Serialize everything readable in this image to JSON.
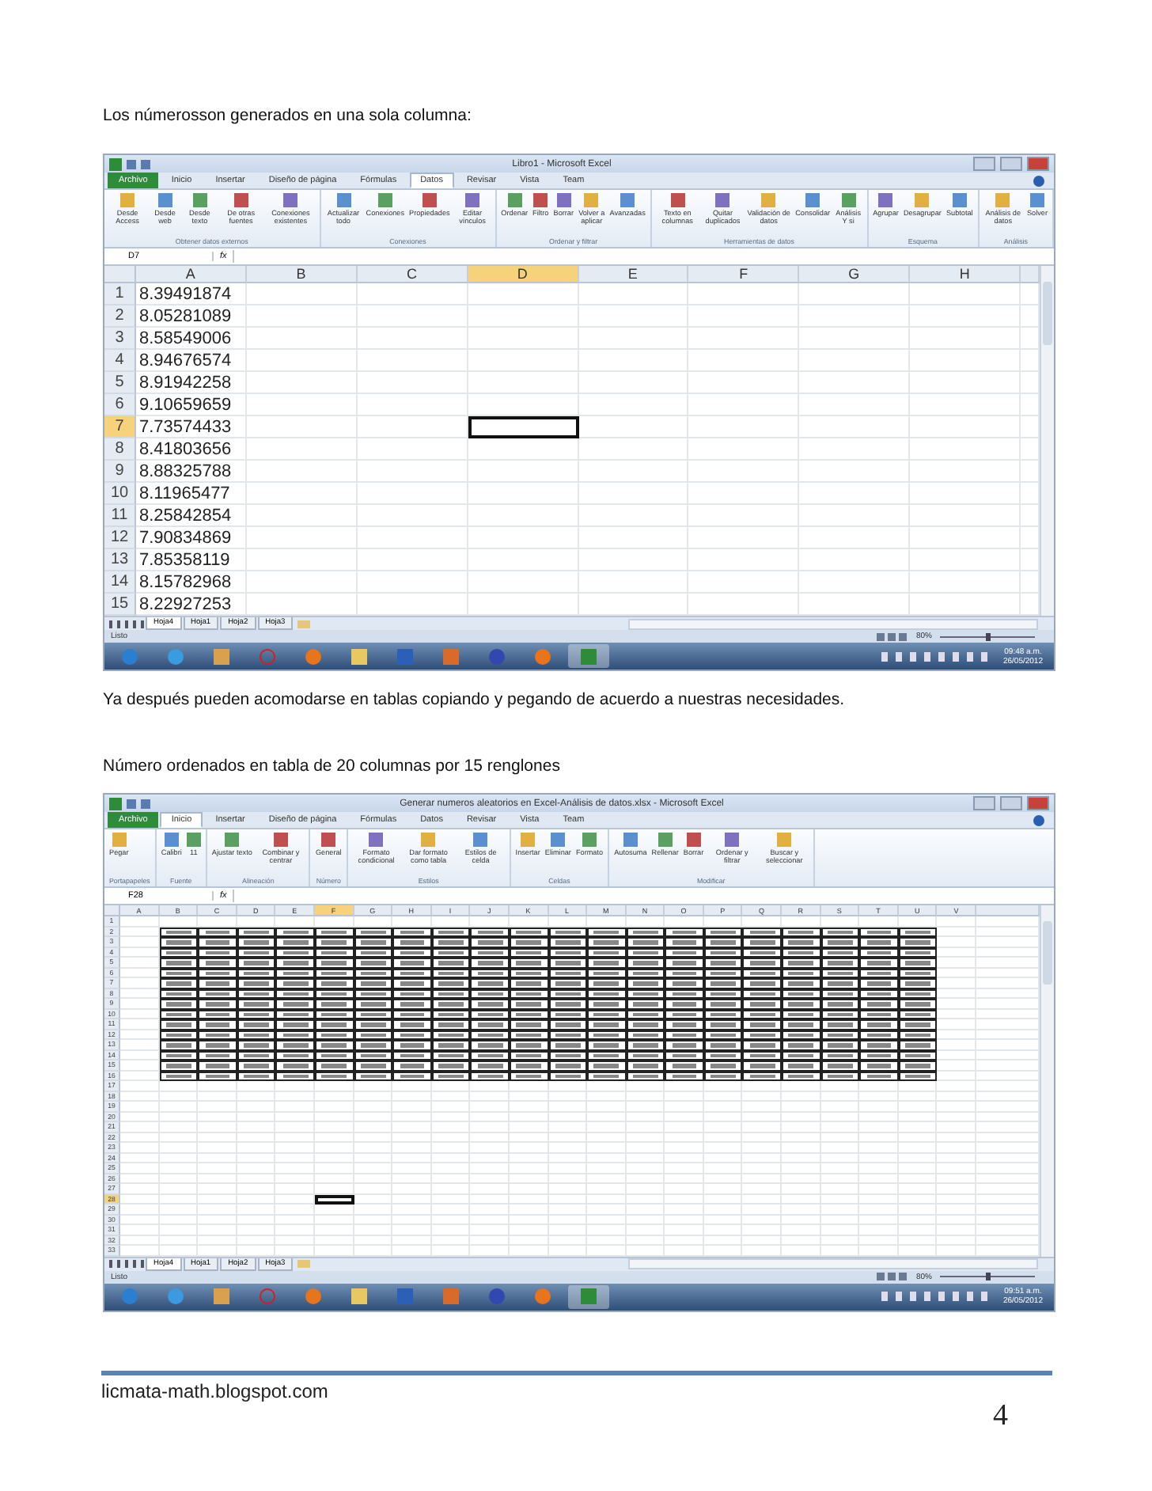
{
  "blocks": [
    {
      "kind": "text",
      "text": "Los númerosson generados en una sola columna:"
    },
    {
      "kind": "excel",
      "title": "Libro1 - Microsoft Excel",
      "tabs": [
        {
          "label": "Archivo",
          "kind": "file",
          "selected": false
        },
        {
          "label": "Inicio",
          "kind": "tab",
          "selected": false
        },
        {
          "label": "Insertar",
          "kind": "tab",
          "selected": false
        },
        {
          "label": "Diseño de página",
          "kind": "tab",
          "selected": false
        },
        {
          "label": "Fórmulas",
          "kind": "tab",
          "selected": false
        },
        {
          "label": "Datos",
          "kind": "tab",
          "selected": true
        },
        {
          "label": "Revisar",
          "kind": "tab",
          "selected": false
        },
        {
          "label": "Vista",
          "kind": "tab",
          "selected": false
        },
        {
          "label": "Team",
          "kind": "tab",
          "selected": false
        }
      ],
      "ribbon": [
        {
          "label": "Obtener datos externos",
          "commands": [
            "Desde Access",
            "Desde web",
            "Desde texto",
            "De otras fuentes",
            "Conexiones existentes"
          ]
        },
        {
          "label": "Conexiones",
          "commands": [
            "Actualizar todo",
            "Conexiones",
            "Propiedades",
            "Editar vínculos"
          ]
        },
        {
          "label": "Ordenar y filtrar",
          "commands": [
            "Ordenar",
            "Filtro",
            "Borrar",
            "Volver a aplicar",
            "Avanzadas"
          ]
        },
        {
          "label": "Herramientas de datos",
          "commands": [
            "Texto en columnas",
            "Quitar duplicados",
            "Validación de datos",
            "Consolidar",
            "Análisis Y si"
          ]
        },
        {
          "label": "Esquema",
          "commands": [
            "Agrupar",
            "Desagrupar",
            "Subtotal"
          ]
        },
        {
          "label": "Análisis",
          "commands": [
            "Análisis de datos",
            "Solver"
          ]
        }
      ],
      "name_box": "D7",
      "function_label": "fx",
      "grid": {
        "kind": "values",
        "columns": [
          {
            "label": "A",
            "kind": "data",
            "selected": false
          },
          {
            "label": "B",
            "kind": "empty",
            "selected": false
          },
          {
            "label": "C",
            "kind": "empty",
            "selected": false
          },
          {
            "label": "D",
            "kind": "empty",
            "selected": true
          },
          {
            "label": "E",
            "kind": "empty",
            "selected": false
          },
          {
            "label": "F",
            "kind": "empty",
            "selected": false
          },
          {
            "label": "G",
            "kind": "empty",
            "selected": false
          },
          {
            "label": "H",
            "kind": "empty",
            "selected": false
          }
        ],
        "rows": [
          {
            "number": "1",
            "selected": false,
            "value": "8.39491874"
          },
          {
            "number": "2",
            "selected": false,
            "value": "8.05281089"
          },
          {
            "number": "3",
            "selected": false,
            "value": "8.58549006"
          },
          {
            "number": "4",
            "selected": false,
            "value": "8.94676574"
          },
          {
            "number": "5",
            "selected": false,
            "value": "8.91942258"
          },
          {
            "number": "6",
            "selected": false,
            "value": "9.10659659"
          },
          {
            "number": "7",
            "selected": true,
            "value": "7.73574433"
          },
          {
            "number": "8",
            "selected": false,
            "value": "8.41803656"
          },
          {
            "number": "9",
            "selected": false,
            "value": "8.88325788"
          },
          {
            "number": "10",
            "selected": false,
            "value": "8.11965477"
          },
          {
            "number": "11",
            "selected": false,
            "value": "8.25842854"
          },
          {
            "number": "12",
            "selected": false,
            "value": "7.90834869"
          },
          {
            "number": "13",
            "selected": false,
            "value": "7.85358119"
          },
          {
            "number": "14",
            "selected": false,
            "value": "8.15782968"
          },
          {
            "number": "15",
            "selected": false,
            "value": "8.22927253"
          }
        ]
      },
      "sheet_tabs": [
        {
          "label": "Hoja4",
          "selected": true
        },
        {
          "label": "Hoja1",
          "selected": false
        },
        {
          "label": "Hoja2",
          "selected": false
        },
        {
          "label": "Hoja3",
          "selected": false
        }
      ],
      "status": "Listo",
      "zoom": "80%",
      "zoom_slider": {
        "level": 0.5
      },
      "taskbar": [
        {
          "kind": "start",
          "selected": false
        },
        {
          "kind": "ie",
          "selected": false
        },
        {
          "kind": "media",
          "selected": false
        },
        {
          "kind": "opera",
          "selected": false
        },
        {
          "kind": "firefox",
          "selected": false
        },
        {
          "kind": "folder",
          "selected": false
        },
        {
          "kind": "word",
          "selected": false
        },
        {
          "kind": "powerpoint",
          "selected": false
        },
        {
          "kind": "globe",
          "selected": false
        },
        {
          "kind": "firefox",
          "selected": false
        },
        {
          "kind": "excel",
          "selected": true
        }
      ],
      "clock": {
        "time": "09:48 a.m.",
        "date": "26/05/2012"
      }
    },
    {
      "kind": "text",
      "text": "Ya después pueden acomodarse en tablas copiando y pegando de acuerdo a nuestras necesidades."
    },
    {
      "kind": "text",
      "text": "Número ordenados en tabla de 20 columnas por 15 renglones"
    },
    {
      "kind": "excel",
      "title": "Generar numeros aleatorios en Excel-Análisis de datos.xlsx - Microsoft Excel",
      "tabs": [
        {
          "label": "Archivo",
          "kind": "file",
          "selected": false
        },
        {
          "label": "Inicio",
          "kind": "tab",
          "selected": true
        },
        {
          "label": "Insertar",
          "kind": "tab",
          "selected": false
        },
        {
          "label": "Diseño de página",
          "kind": "tab",
          "selected": false
        },
        {
          "label": "Fórmulas",
          "kind": "tab",
          "selected": false
        },
        {
          "label": "Datos",
          "kind": "tab",
          "selected": false
        },
        {
          "label": "Revisar",
          "kind": "tab",
          "selected": false
        },
        {
          "label": "Vista",
          "kind": "tab",
          "selected": false
        },
        {
          "label": "Team",
          "kind": "tab",
          "selected": false
        }
      ],
      "ribbon": [
        {
          "label": "Portapapeles",
          "commands": [
            "Pegar"
          ]
        },
        {
          "label": "Fuente",
          "commands": [
            "Calibri",
            "11"
          ]
        },
        {
          "label": "Alineación",
          "commands": [
            "Ajustar texto",
            "Combinar y centrar"
          ]
        },
        {
          "label": "Número",
          "commands": [
            "General"
          ]
        },
        {
          "label": "Estilos",
          "commands": [
            "Formato condicional",
            "Dar formato como tabla",
            "Estilos de celda"
          ]
        },
        {
          "label": "Celdas",
          "commands": [
            "Insertar",
            "Eliminar",
            "Formato"
          ]
        },
        {
          "label": "Modificar",
          "commands": [
            "Autosuma",
            "Rellenar",
            "Borrar",
            "Ordenar y filtrar",
            "Buscar y seleccionar"
          ]
        }
      ],
      "name_box": "F28",
      "function_label": "fx",
      "grid": {
        "kind": "table",
        "columns": [
          {
            "label": "A",
            "kind": "empty",
            "selected": false
          },
          {
            "label": "B",
            "kind": "data",
            "selected": false
          },
          {
            "label": "C",
            "kind": "data",
            "selected": false
          },
          {
            "label": "D",
            "kind": "data",
            "selected": false
          },
          {
            "label": "E",
            "kind": "data",
            "selected": false
          },
          {
            "label": "F",
            "kind": "data",
            "selected": true
          },
          {
            "label": "G",
            "kind": "data",
            "selected": false
          },
          {
            "label": "H",
            "kind": "data",
            "selected": false
          },
          {
            "label": "I",
            "kind": "data",
            "selected": false
          },
          {
            "label": "J",
            "kind": "data",
            "selected": false
          },
          {
            "label": "K",
            "kind": "data",
            "selected": false
          },
          {
            "label": "L",
            "kind": "data",
            "selected": false
          },
          {
            "label": "M",
            "kind": "data",
            "selected": false
          },
          {
            "label": "N",
            "kind": "data",
            "selected": false
          },
          {
            "label": "O",
            "kind": "data",
            "selected": false
          },
          {
            "label": "P",
            "kind": "data",
            "selected": false
          },
          {
            "label": "Q",
            "kind": "data",
            "selected": false
          },
          {
            "label": "R",
            "kind": "data",
            "selected": false
          },
          {
            "label": "S",
            "kind": "data",
            "selected": false
          },
          {
            "label": "T",
            "kind": "data",
            "selected": false
          },
          {
            "label": "U",
            "kind": "data",
            "selected": false
          },
          {
            "label": "V",
            "kind": "empty",
            "selected": false
          }
        ],
        "rows": [
          {
            "number": "1",
            "kind": "empty",
            "selected": false
          },
          {
            "number": "2",
            "kind": "data",
            "selected": false
          },
          {
            "number": "3",
            "kind": "data",
            "selected": false
          },
          {
            "number": "4",
            "kind": "data",
            "selected": false
          },
          {
            "number": "5",
            "kind": "data",
            "selected": false
          },
          {
            "number": "6",
            "kind": "data",
            "selected": false
          },
          {
            "number": "7",
            "kind": "data",
            "selected": false
          },
          {
            "number": "8",
            "kind": "data",
            "selected": false
          },
          {
            "number": "9",
            "kind": "data",
            "selected": false
          },
          {
            "number": "10",
            "kind": "data",
            "selected": false
          },
          {
            "number": "11",
            "kind": "data",
            "selected": false
          },
          {
            "number": "12",
            "kind": "data",
            "selected": false
          },
          {
            "number": "13",
            "kind": "data",
            "selected": false
          },
          {
            "number": "14",
            "kind": "data",
            "selected": false
          },
          {
            "number": "15",
            "kind": "data",
            "selected": false
          },
          {
            "number": "16",
            "kind": "data",
            "selected": false
          },
          {
            "number": "17",
            "kind": "empty",
            "selected": false
          },
          {
            "number": "18",
            "kind": "empty",
            "selected": false
          },
          {
            "number": "19",
            "kind": "empty",
            "selected": false
          },
          {
            "number": "20",
            "kind": "empty",
            "selected": false
          },
          {
            "number": "21",
            "kind": "empty",
            "selected": false
          },
          {
            "number": "22",
            "kind": "empty",
            "selected": false
          },
          {
            "number": "23",
            "kind": "empty",
            "selected": false
          },
          {
            "number": "24",
            "kind": "empty",
            "selected": false
          },
          {
            "number": "25",
            "kind": "empty",
            "selected": false
          },
          {
            "number": "26",
            "kind": "empty",
            "selected": false
          },
          {
            "number": "27",
            "kind": "empty",
            "selected": false
          },
          {
            "number": "28",
            "kind": "empty",
            "selected": true
          },
          {
            "number": "29",
            "kind": "empty",
            "selected": false
          },
          {
            "number": "30",
            "kind": "empty",
            "selected": false
          },
          {
            "number": "31",
            "kind": "empty",
            "selected": false
          },
          {
            "number": "32",
            "kind": "empty",
            "selected": false
          },
          {
            "number": "33",
            "kind": "empty",
            "selected": false
          }
        ]
      },
      "sheet_tabs": [
        {
          "label": "Hoja4",
          "selected": true
        },
        {
          "label": "Hoja1",
          "selected": false
        },
        {
          "label": "Hoja2",
          "selected": false
        },
        {
          "label": "Hoja3",
          "selected": false
        }
      ],
      "status": "Listo",
      "zoom": "80%",
      "zoom_slider": {
        "level": 0.5
      },
      "taskbar": [
        {
          "kind": "start",
          "selected": false
        },
        {
          "kind": "ie",
          "selected": false
        },
        {
          "kind": "media",
          "selected": false
        },
        {
          "kind": "opera",
          "selected": false
        },
        {
          "kind": "firefox",
          "selected": false
        },
        {
          "kind": "folder",
          "selected": false
        },
        {
          "kind": "word",
          "selected": false
        },
        {
          "kind": "powerpoint",
          "selected": false
        },
        {
          "kind": "globe",
          "selected": false
        },
        {
          "kind": "firefox",
          "selected": false
        },
        {
          "kind": "excel",
          "selected": true
        }
      ],
      "clock": {
        "time": "09:51 a.m.",
        "date": "26/05/2012"
      }
    }
  ],
  "footer": {
    "site": "licmata-math.blogspot.com",
    "page_number": "4"
  }
}
